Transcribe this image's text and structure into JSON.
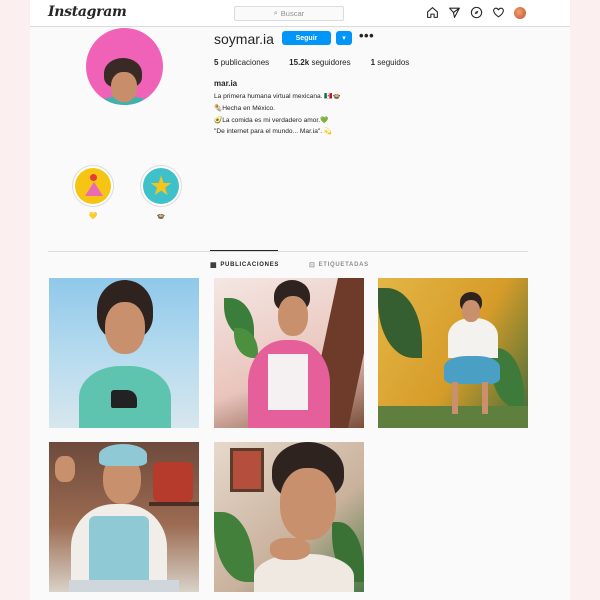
{
  "topbar": {
    "logo_text": "Instagram",
    "search_placeholder": "Buscar",
    "icons": [
      "home-icon",
      "direct-icon",
      "explore-icon",
      "activity-icon",
      "avatar"
    ]
  },
  "profile": {
    "username": "soymar.ia",
    "follow_label": "Seguir",
    "dropdown_glyph": "▾",
    "more_glyph": "•••",
    "stats": [
      {
        "value": "5",
        "label": "publicaciones"
      },
      {
        "value": "15.2k",
        "label": "seguidores"
      },
      {
        "value": "1",
        "label": "seguidos"
      }
    ],
    "full_name": "mar.ia",
    "bio_lines": [
      "La primera humana virtual mexicana. 🇲🇽🍲",
      "🌯Hecha en México.",
      "🥑La comida es mi verdadero amor.💚",
      "\"De internet para el mundo... Mar.ia\". 💫"
    ]
  },
  "highlights": [
    {
      "label": "💛",
      "icon": "triangle-icon"
    },
    {
      "label": "🍲",
      "icon": "star-icon"
    }
  ],
  "tabs": [
    {
      "label": "PUBLICACIONES",
      "icon": "grid-icon",
      "active": true
    },
    {
      "label": "ETIQUETADAS",
      "icon": "tag-icon",
      "active": false
    }
  ],
  "colors": {
    "accent": "#0095f6",
    "profile_bg": "#f062b8"
  },
  "posts": [
    "post-1",
    "post-2",
    "post-3",
    "post-4",
    "post-5"
  ]
}
